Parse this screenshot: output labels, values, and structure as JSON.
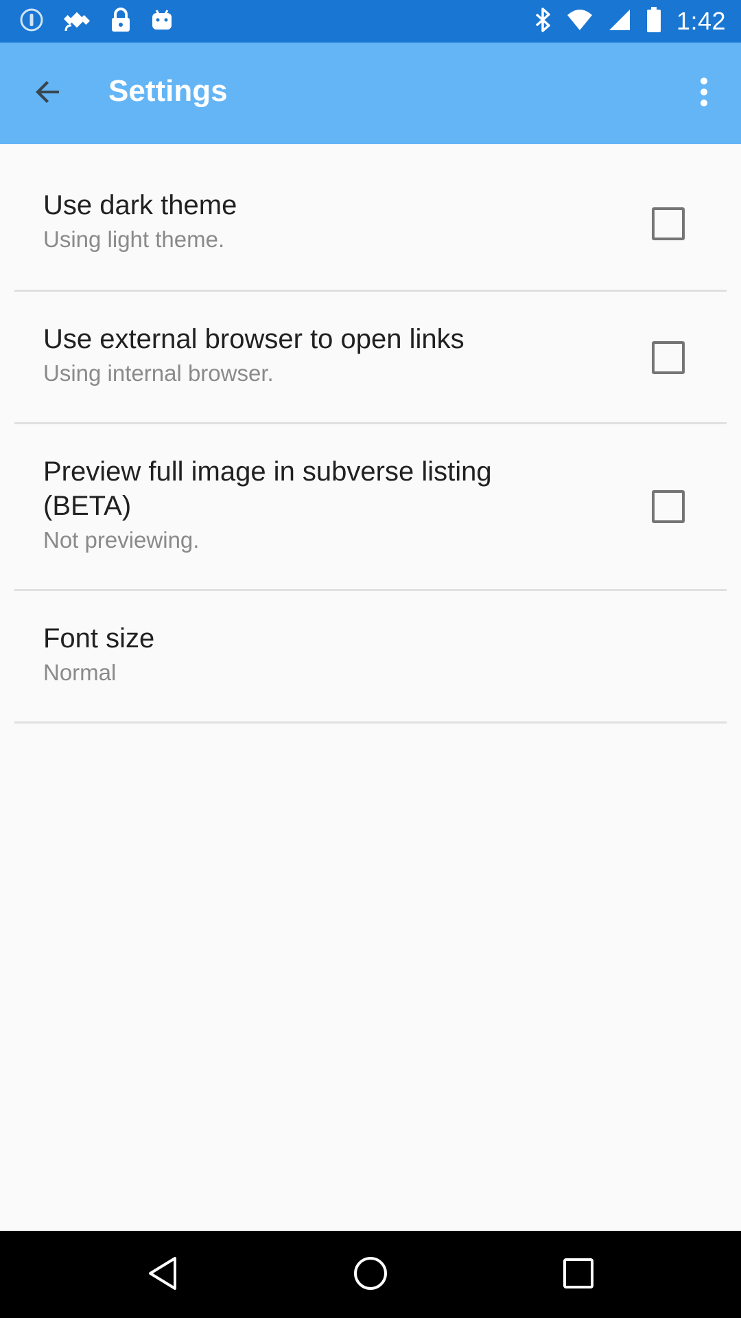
{
  "status_bar": {
    "time": "1:42",
    "left_icons": [
      "info-circle-icon",
      "fake-gps-icon",
      "lock-icon",
      "android-icon"
    ],
    "right_icons": [
      "bluetooth-icon"
    ]
  },
  "app_bar": {
    "title": "Settings",
    "background": "#64b5f6",
    "status_background": "#1976d2"
  },
  "settings": [
    {
      "title": "Use dark theme",
      "summary": "Using light theme.",
      "checked": false
    },
    {
      "title": "Use external browser to open links",
      "summary": "Using internal browser.",
      "checked": false
    },
    {
      "title": "Preview full image in subverse listing (BETA)",
      "summary": "Not previewing.",
      "checked": false
    },
    {
      "title": "Font size",
      "summary": "Normal"
    }
  ],
  "nav_bar": {
    "buttons": [
      "back-icon",
      "home-icon",
      "recents-icon"
    ]
  }
}
